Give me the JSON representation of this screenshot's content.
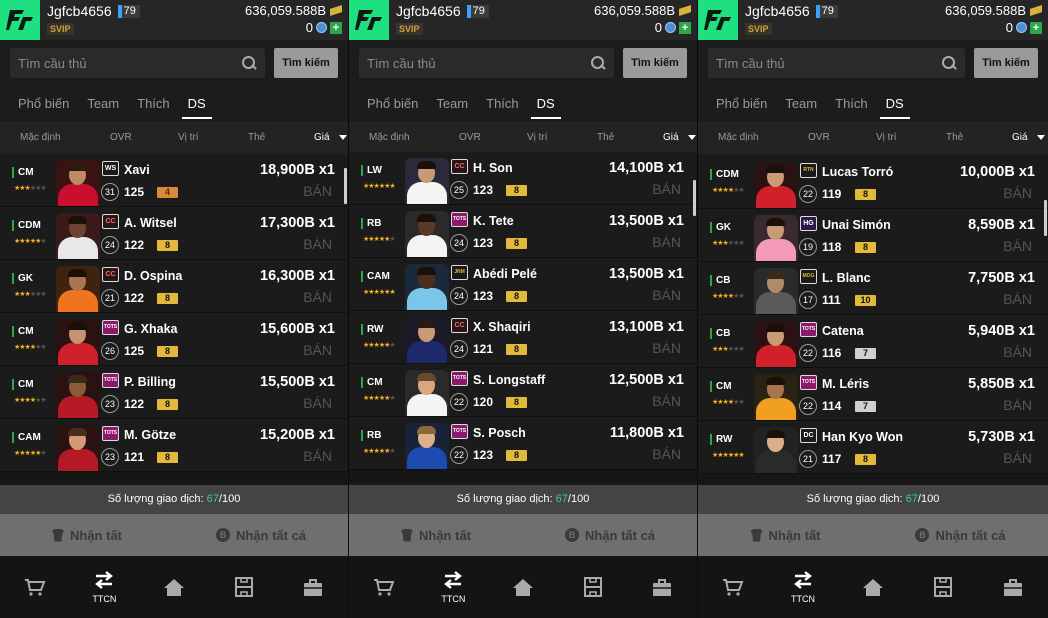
{
  "user": {
    "username": "Jgfcb4656",
    "level": "79",
    "vip": "SVIP",
    "balance": "636,059.588B",
    "points": "0"
  },
  "search": {
    "placeholder": "Tìm cầu thủ",
    "button": "Tìm kiếm"
  },
  "tabs": [
    "Phổ biến",
    "Team",
    "Thích",
    "DS"
  ],
  "active_tab": "DS",
  "sort": {
    "default": "Mặc định",
    "ovr": "OVR",
    "position": "Vị trí",
    "card": "Thẻ",
    "price": "Giá"
  },
  "sell_label": "BÁN",
  "trade_count": {
    "label": "Số lượng giao dịch:",
    "used": "67",
    "total": "/100"
  },
  "actions": {
    "claim": "Nhận tất",
    "claim_all": "Nhận tất cả"
  },
  "nav": {
    "market": "",
    "trade": "TTCN",
    "home": "",
    "squad": "",
    "bag": ""
  },
  "colors": {
    "logo": "#1fe080",
    "grade_gold": "#e2b93b",
    "grade_orange": "#d98a3a",
    "grade_silver": "#cfcfcf",
    "position_bar": "#2aa84a",
    "star": "#f2b01e",
    "trade_used": "#35d27a"
  },
  "panels": [
    {
      "scroll_position": 0.06,
      "rows": [
        {
          "pos": "CM",
          "stars": 3,
          "season": "WS",
          "season_color": "#1a1a1a",
          "season_text": "#fff",
          "ovr_circle": "31",
          "ovr": "125",
          "grade": "4",
          "grade_color": "orange",
          "name": "Xavi",
          "price": "18,900B x1",
          "kit": "#c8102e",
          "skin": "#c08a63",
          "hair": "#2a1a12",
          "bg": "#3a1212"
        },
        {
          "pos": "CDM",
          "stars": 5,
          "season": "CC",
          "season_color": "#2a1515",
          "season_text": "#ff6a6a",
          "ovr_circle": "24",
          "ovr": "122",
          "grade": "8",
          "grade_color": "gold",
          "name": "A. Witsel",
          "price": "17,300B x1",
          "kit": "#e8e8e8",
          "skin": "#6b4532",
          "hair": "#1a1008",
          "bg": "#3a1a1a"
        },
        {
          "pos": "GK",
          "stars": 3,
          "season": "CC",
          "season_color": "#2a1515",
          "season_text": "#ff6a6a",
          "ovr_circle": "21",
          "ovr": "122",
          "grade": "8",
          "grade_color": "gold",
          "name": "D. Ospina",
          "price": "16,300B x1",
          "kit": "#f07320",
          "skin": "#a87552",
          "hair": "#1a1008",
          "bg": "#40220f"
        },
        {
          "pos": "CM",
          "stars": 4,
          "season": "TOTS",
          "season_color": "#8b1a6b",
          "season_text": "#fff",
          "ovr_circle": "26",
          "ovr": "125",
          "grade": "8",
          "grade_color": "gold",
          "name": "G. Xhaka",
          "price": "15,600B x1",
          "kit": "#d0202a",
          "skin": "#c69370",
          "hair": "#1a1008",
          "bg": "#2a1212"
        },
        {
          "pos": "CM",
          "stars": 4,
          "season": "TOTS",
          "season_color": "#8b1a6b",
          "season_text": "#fff",
          "ovr_circle": "23",
          "ovr": "122",
          "grade": "8",
          "grade_color": "gold",
          "name": "P. Billing",
          "price": "15,500B x1",
          "kit": "#b51a24",
          "skin": "#8a5a3a",
          "hair": "#3a2a1a",
          "bg": "#2a1212"
        },
        {
          "pos": "CAM",
          "stars": 5,
          "season": "TOTS",
          "season_color": "#8b1a6b",
          "season_text": "#fff",
          "ovr_circle": "23",
          "ovr": "121",
          "grade": "8",
          "grade_color": "gold",
          "name": "M. Götze",
          "price": "15,200B x1",
          "kit": "#b51a24",
          "skin": "#d29a76",
          "hair": "#4a2e1c",
          "bg": "#2a1212"
        }
      ]
    },
    {
      "scroll_position": 0.12,
      "rows": [
        {
          "pos": "LW",
          "stars": 6,
          "season": "CC",
          "season_color": "#2a1515",
          "season_text": "#ff6a6a",
          "ovr_circle": "25",
          "ovr": "123",
          "grade": "8",
          "grade_color": "gold",
          "name": "H. Son",
          "price": "14,100B x1",
          "kit": "#f4f4f4",
          "skin": "#c99a76",
          "hair": "#1a1008",
          "bg": "#2a2a3a"
        },
        {
          "pos": "RB",
          "stars": 5,
          "season": "TOTS",
          "season_color": "#8b1a6b",
          "season_text": "#fff",
          "ovr_circle": "24",
          "ovr": "123",
          "grade": "8",
          "grade_color": "gold",
          "name": "K. Tete",
          "price": "13,500B x1",
          "kit": "#f4f4f4",
          "skin": "#5a3a26",
          "hair": "#1a1008",
          "bg": "#2a2a2a"
        },
        {
          "pos": "CAM",
          "stars": 6,
          "season": "JNM",
          "season_color": "#1a1a1a",
          "season_text": "#e2b93b",
          "ovr_circle": "24",
          "ovr": "123",
          "grade": "8",
          "grade_color": "gold",
          "name": "Abédi Pelé",
          "price": "13,500B x1",
          "kit": "#7bc6e8",
          "skin": "#4a2e1c",
          "hair": "#1a1008",
          "bg": "#1a2a3a"
        },
        {
          "pos": "RW",
          "stars": 5,
          "season": "CC",
          "season_color": "#2a1515",
          "season_text": "#ff6a6a",
          "ovr_circle": "24",
          "ovr": "121",
          "grade": "8",
          "grade_color": "gold",
          "name": "X. Shaqiri",
          "price": "13,100B x1",
          "kit": "#1f2a6b",
          "skin": "#c99a76",
          "hair": "#2a1a12",
          "bg": "#1a1a2a"
        },
        {
          "pos": "CM",
          "stars": 5,
          "season": "TOTS",
          "season_color": "#8b1a6b",
          "season_text": "#fff",
          "ovr_circle": "22",
          "ovr": "120",
          "grade": "8",
          "grade_color": "gold",
          "name": "S. Longstaff",
          "price": "12,500B x1",
          "kit": "#f4f4f4",
          "skin": "#d9a680",
          "hair": "#6a4a2a",
          "bg": "#2a2a2a"
        },
        {
          "pos": "RB",
          "stars": 5,
          "season": "TOTS",
          "season_color": "#8b1a6b",
          "season_text": "#fff",
          "ovr_circle": "22",
          "ovr": "123",
          "grade": "8",
          "grade_color": "gold",
          "name": "S. Posch",
          "price": "11,800B x1",
          "kit": "#1e4bb0",
          "skin": "#e0b08a",
          "hair": "#8a6a3a",
          "bg": "#1a223a"
        }
      ]
    },
    {
      "scroll_position": 0.22,
      "rows": [
        {
          "pos": "CDM",
          "stars": 4,
          "season": "RTN",
          "season_color": "#1a1a1a",
          "season_text": "#e2b93b",
          "ovr_circle": "22",
          "ovr": "119",
          "grade": "8",
          "grade_color": "gold",
          "name": "Lucas Torró",
          "price": "10,000B x1",
          "kit": "#d0202a",
          "skin": "#c99a76",
          "hair": "#1a1008",
          "bg": "#2a1212"
        },
        {
          "pos": "GK",
          "stars": 3,
          "season": "HG",
          "season_color": "#2a1a4a",
          "season_text": "#fff",
          "ovr_circle": "19",
          "ovr": "118",
          "grade": "8",
          "grade_color": "gold",
          "name": "Unai Simón",
          "price": "8,590B x1",
          "kit": "#f29ab8",
          "skin": "#c99a76",
          "hair": "#1a1008",
          "bg": "#3a2a30"
        },
        {
          "pos": "CB",
          "stars": 4,
          "season": "MOG",
          "season_color": "#1a1a1a",
          "season_text": "#e2b93b",
          "ovr_circle": "17",
          "ovr": "111",
          "grade": "10",
          "grade_color": "gold",
          "name": "L. Blanc",
          "price": "7,750B x1",
          "kit": "#5a5a5a",
          "skin": "#b08a6a",
          "hair": "#3a2a1a",
          "bg": "#2a2a2a"
        },
        {
          "pos": "CB",
          "stars": 3,
          "season": "TOTS",
          "season_color": "#8b1a6b",
          "season_text": "#fff",
          "ovr_circle": "22",
          "ovr": "116",
          "grade": "7",
          "grade_color": "silver",
          "name": "Catena",
          "price": "5,940B x1",
          "kit": "#d0202a",
          "skin": "#c99a76",
          "hair": "#1a1008",
          "bg": "#2a1212"
        },
        {
          "pos": "CM",
          "stars": 4,
          "season": "TOTS",
          "season_color": "#8b1a6b",
          "season_text": "#fff",
          "ovr_circle": "22",
          "ovr": "114",
          "grade": "7",
          "grade_color": "silver",
          "name": "M. Léris",
          "price": "5,850B x1",
          "kit": "#f0a020",
          "skin": "#a87552",
          "hair": "#1a1008",
          "bg": "#2a2212"
        },
        {
          "pos": "RW",
          "stars": 6,
          "season": "DC",
          "season_color": "#1a1a1a",
          "season_text": "#fff",
          "ovr_circle": "21",
          "ovr": "117",
          "grade": "8",
          "grade_color": "gold",
          "name": "Han Kyo Won",
          "price": "5,730B x1",
          "kit": "#2a2a2a",
          "skin": "#d9b08a",
          "hair": "#1a1008",
          "bg": "#222"
        }
      ]
    }
  ]
}
